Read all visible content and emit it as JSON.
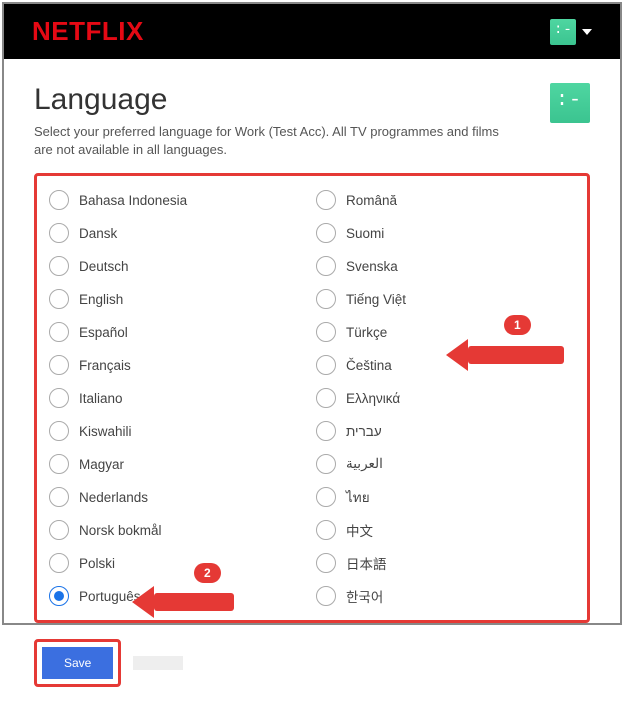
{
  "brand": "NETFLIX",
  "page": {
    "title": "Language",
    "subtitle": "Select your preferred language for Work (Test Acc). All TV programmes and films are not available in all languages."
  },
  "languages_left": [
    "Bahasa Indonesia",
    "Dansk",
    "Deutsch",
    "English",
    "Español",
    "Français",
    "Italiano",
    "Kiswahili",
    "Magyar",
    "Nederlands",
    "Norsk bokmål",
    "Polski",
    "Português"
  ],
  "languages_right": [
    "Română",
    "Suomi",
    "Svenska",
    "Tiếng Việt",
    "Türkçe",
    "Čeština",
    "Ελληνικά",
    "עברית",
    "العربية",
    "ไทย",
    "中文",
    "日本語",
    "한국어"
  ],
  "selected_language": "Português",
  "buttons": {
    "save": "Save"
  },
  "annotations": {
    "step1": "1",
    "step2": "2"
  }
}
